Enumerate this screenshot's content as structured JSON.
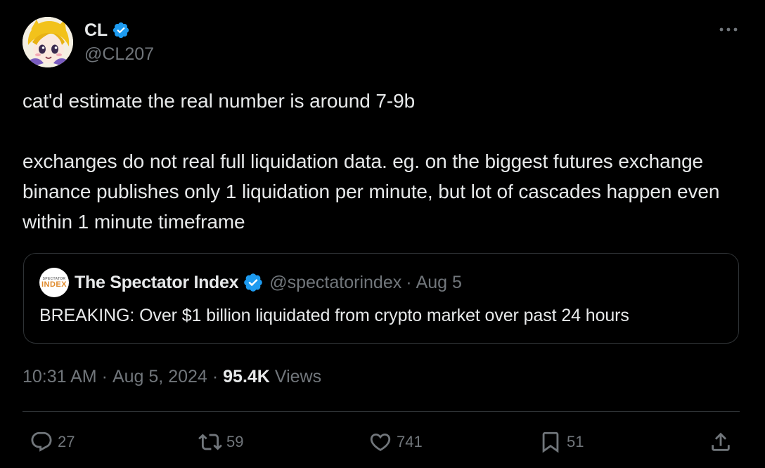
{
  "author": {
    "display_name": "CL",
    "handle": "@CL207",
    "verified": true
  },
  "post": {
    "text": "cat'd estimate the real number is around 7-9b\n\nexchanges do not real full liquidation data. eg. on the biggest futures exchange binance publishes only 1 liquidation per minute, but lot of cascades happen even within 1 minute timeframe"
  },
  "quoted_post": {
    "avatar_text_line1": "SPECTATOR",
    "avatar_text_line2": "INDEX",
    "display_name": "The Spectator Index",
    "handle": "@spectatorindex",
    "separator": "·",
    "date": "Aug 5",
    "text": "BREAKING: Over $1 billion liquidated from crypto market over past 24 hours"
  },
  "meta": {
    "time": "10:31 AM",
    "separator": "·",
    "date": "Aug 5, 2024",
    "views_count": "95.4K",
    "views_label": "Views"
  },
  "actions": {
    "replies": "27",
    "reposts": "59",
    "likes": "741",
    "bookmarks": "51"
  },
  "icons": {
    "more": "more-horizontal-icon",
    "verified": "verified-badge-icon",
    "reply": "reply-icon",
    "repost": "repost-icon",
    "like": "heart-icon",
    "bookmark": "bookmark-icon",
    "share": "share-icon"
  },
  "colors": {
    "background": "#000000",
    "text_primary": "#e7e9ea",
    "text_secondary": "#71767b",
    "border": "#2f3336",
    "verified_blue": "#1d9bf0"
  }
}
